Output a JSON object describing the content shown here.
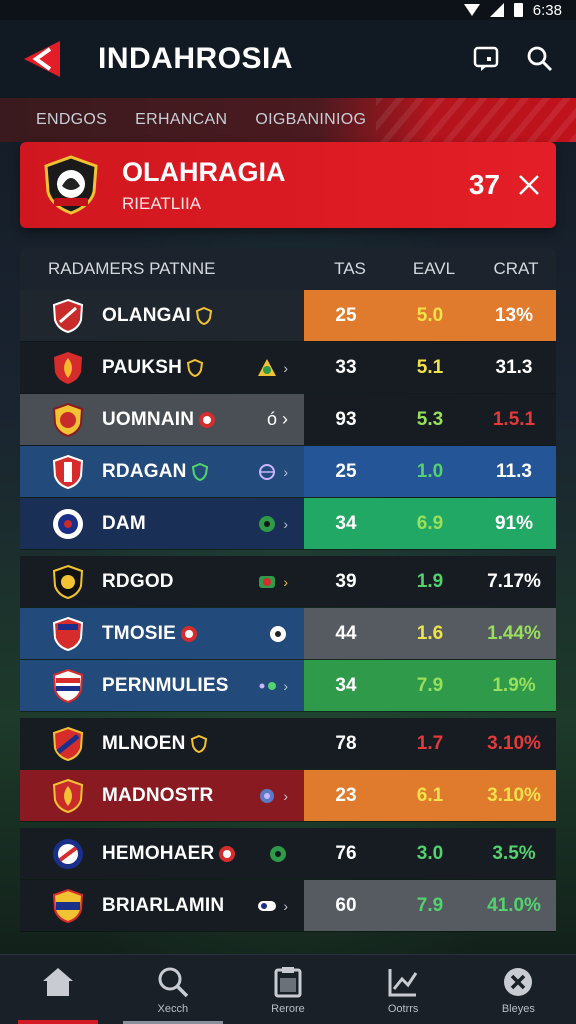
{
  "status": {
    "time": "6:38"
  },
  "app": {
    "title": "INDAHROSIA"
  },
  "tabs": [
    "ENDGOS",
    "ERHANCAN",
    "OIGBANINIOG"
  ],
  "hero": {
    "title": "OLAHRAGIA",
    "subtitle": "RIEATLIIA",
    "score": "37"
  },
  "table": {
    "headers": {
      "name": "RADAMERS PATNNE",
      "col1": "TAS",
      "col2": "EAVL",
      "col3": "CRAT"
    },
    "rows": [
      {
        "name": "OLANGAI",
        "v1": "25",
        "v2": "5.0",
        "v3": "13%"
      },
      {
        "name": "PAUKSH",
        "v1": "33",
        "v2": "5.1",
        "v3": "31.3"
      },
      {
        "name": "UOMNAIN",
        "v1": "93",
        "v2": "5.3",
        "v3": "1.5.1"
      },
      {
        "name": "RDAGAN",
        "v1": "25",
        "v2": "1.0",
        "v3": "11.3"
      },
      {
        "name": "DAM",
        "v1": "34",
        "v2": "6.9",
        "v3": "91%"
      },
      {
        "name": "RDGOD",
        "v1": "39",
        "v2": "1.9",
        "v3": "7.17%"
      },
      {
        "name": "TMOSIE",
        "v1": "44",
        "v2": "1.6",
        "v3": "1.44%"
      },
      {
        "name": "PERNMULIES",
        "v1": "34",
        "v2": "7.9",
        "v3": "1.9%"
      },
      {
        "name": "MLNOEN",
        "v1": "78",
        "v2": "1.7",
        "v3": "3.10%"
      },
      {
        "name": "MADNOSTR",
        "v1": "23",
        "v2": "6.1",
        "v3": "3.10%"
      },
      {
        "name": "HEMOHAER",
        "v1": "76",
        "v2": "3.0",
        "v3": "3.5%"
      },
      {
        "name": "BRIARLAMIN",
        "v1": "60",
        "v2": "7.9",
        "v3": "41.0%"
      }
    ]
  },
  "nav": [
    {
      "label": "",
      "icon": "home-icon"
    },
    {
      "label": "Xecch",
      "icon": "search-icon"
    },
    {
      "label": "Rerore",
      "icon": "clipboard-icon"
    },
    {
      "label": "Ootrrs",
      "icon": "chart-icon"
    },
    {
      "label": "Bleyes",
      "icon": "close-circle-icon"
    }
  ],
  "colors": {
    "accent": "#e41e26",
    "orange": "#e07a2c",
    "green": "#22a865",
    "blue": "#245596"
  }
}
